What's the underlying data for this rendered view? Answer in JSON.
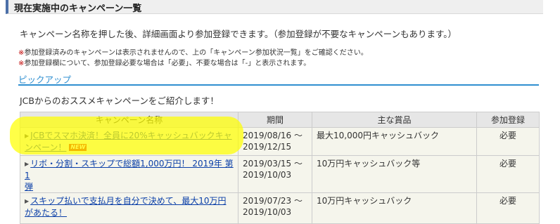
{
  "header": {
    "title": "現在実施中のキャンペーン一覧"
  },
  "intro_text": "キャンペーン名称を押した後、詳細画面より参加登録できます。（参加登録が不要なキャンペーンもあります。）",
  "notes": [
    {
      "mark": "※",
      "text": "参加登録済みのキャンペーンは表示されませんので、上の「キャンペーン参加状況一覧」をご確認ください。"
    },
    {
      "mark": "※",
      "text": "参加登録欄について、参加登録必要な場合は「必要」、不要な場合は「-」と表示されます。"
    }
  ],
  "pickup": {
    "section_title": "ピックアップ",
    "lead": "JCBからのおススメキャンペーンをご紹介します！"
  },
  "table": {
    "headers": [
      "キャンペーン名称",
      "期間",
      "主な賞品",
      "参加登録"
    ],
    "rows": [
      {
        "name_line1": "JCBでスマホ決済！全員に20%キャッシュバックキャ",
        "name_line2": "ンペーン！",
        "badge": "NEW",
        "period_line1": "2019/08/16 〜",
        "period_line2": "2019/12/15",
        "prize": "最大10,000円キャッシュバック",
        "registration": "必要"
      },
      {
        "name_line1": "リボ・分割・スキップで総額1,000万円！ 2019年 第1",
        "name_line2": "弾",
        "period_line1": "2019/03/15 〜",
        "period_line2": "2019/10/03",
        "prize": "10万円キャッシュバック等",
        "registration": "必要"
      },
      {
        "name_line1": "スキップ払いで支払月を自分で決めて、最大10万円",
        "name_line2": "があたる！",
        "period_line1": "2019/07/23 〜",
        "period_line2": "2019/10/03",
        "prize": "10万円キャッシュバック",
        "registration": "必要"
      }
    ]
  },
  "colors": {
    "header_accent": "#4b6fa8",
    "section_accent": "#2f8fd0",
    "link": "#0b3fa8",
    "highlight": "#ffff00",
    "new_badge": "#d80000"
  }
}
